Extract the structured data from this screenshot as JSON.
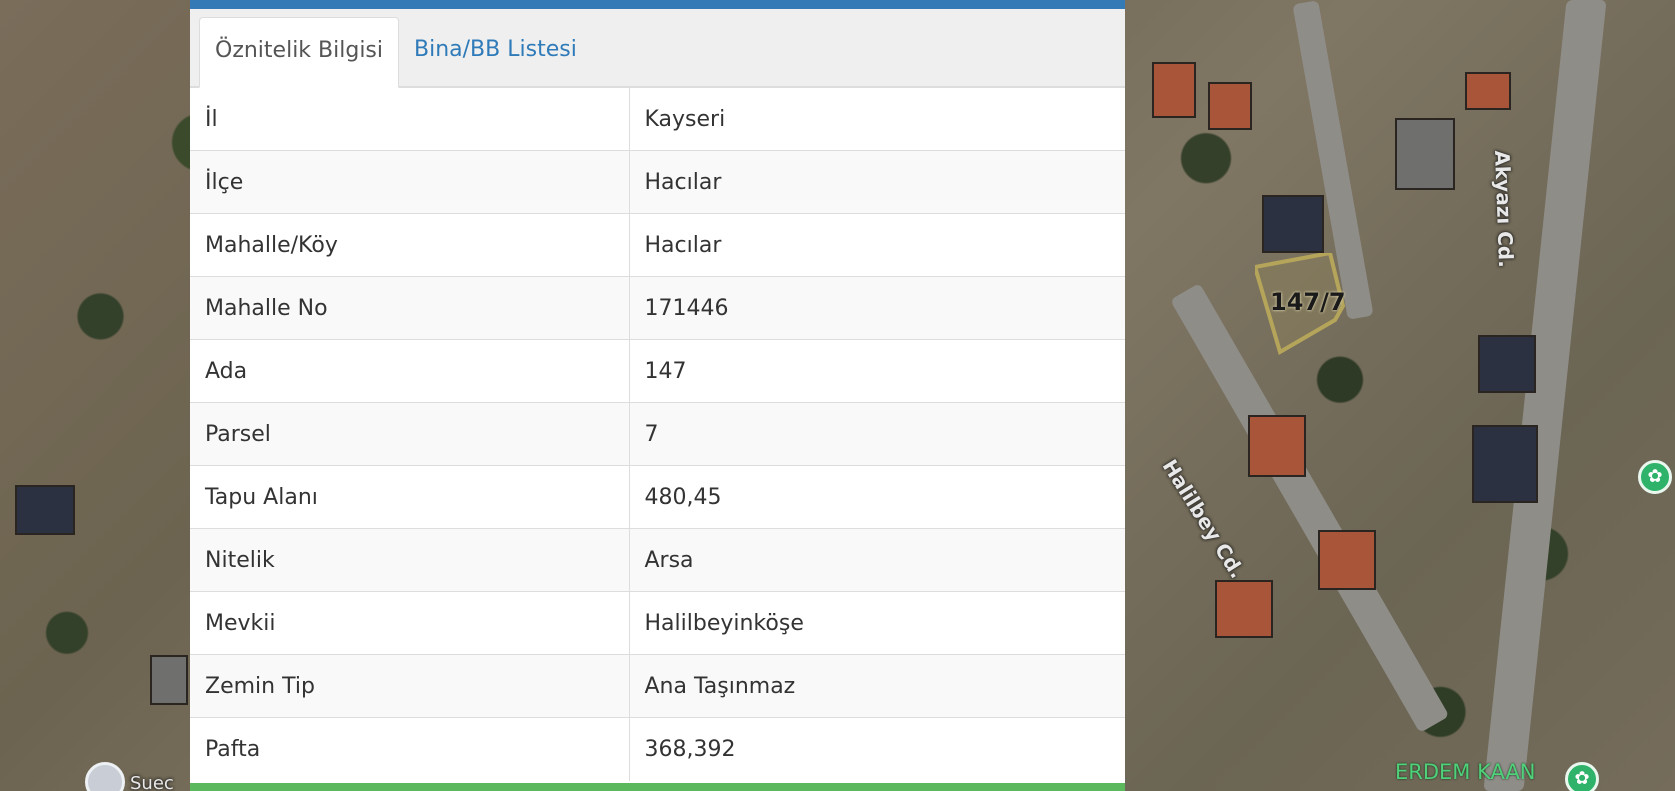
{
  "map": {
    "parcel_label": "147/7",
    "road_labels": [
      "Akyazı Cd.",
      "Halilbey Cd."
    ],
    "poi_label": "ERDEM KAAN",
    "partial_label": "Suec"
  },
  "panel": {
    "tabs": [
      {
        "label": "Öznitelik Bilgisi",
        "active": true
      },
      {
        "label": "Bina/BB Listesi",
        "active": false
      }
    ],
    "rows": [
      {
        "label": "İl",
        "value": "Kayseri"
      },
      {
        "label": "İlçe",
        "value": "Hacılar"
      },
      {
        "label": "Mahalle/Köy",
        "value": "Hacılar"
      },
      {
        "label": "Mahalle No",
        "value": "171446"
      },
      {
        "label": "Ada",
        "value": "147"
      },
      {
        "label": "Parsel",
        "value": "7"
      },
      {
        "label": "Tapu Alanı",
        "value": "480,45"
      },
      {
        "label": "Nitelik",
        "value": "Arsa"
      },
      {
        "label": "Mevkii",
        "value": "Halilbeyinköşe"
      },
      {
        "label": "Zemin Tip",
        "value": "Ana Taşınmaz"
      },
      {
        "label": "Pafta",
        "value": "368,392"
      }
    ]
  },
  "colors": {
    "panel_top_border": "#337ab7",
    "panel_bottom_bar": "#5cb85c",
    "tab_link": "#2f7ab8",
    "parcel_outline": "#b5a55a"
  }
}
